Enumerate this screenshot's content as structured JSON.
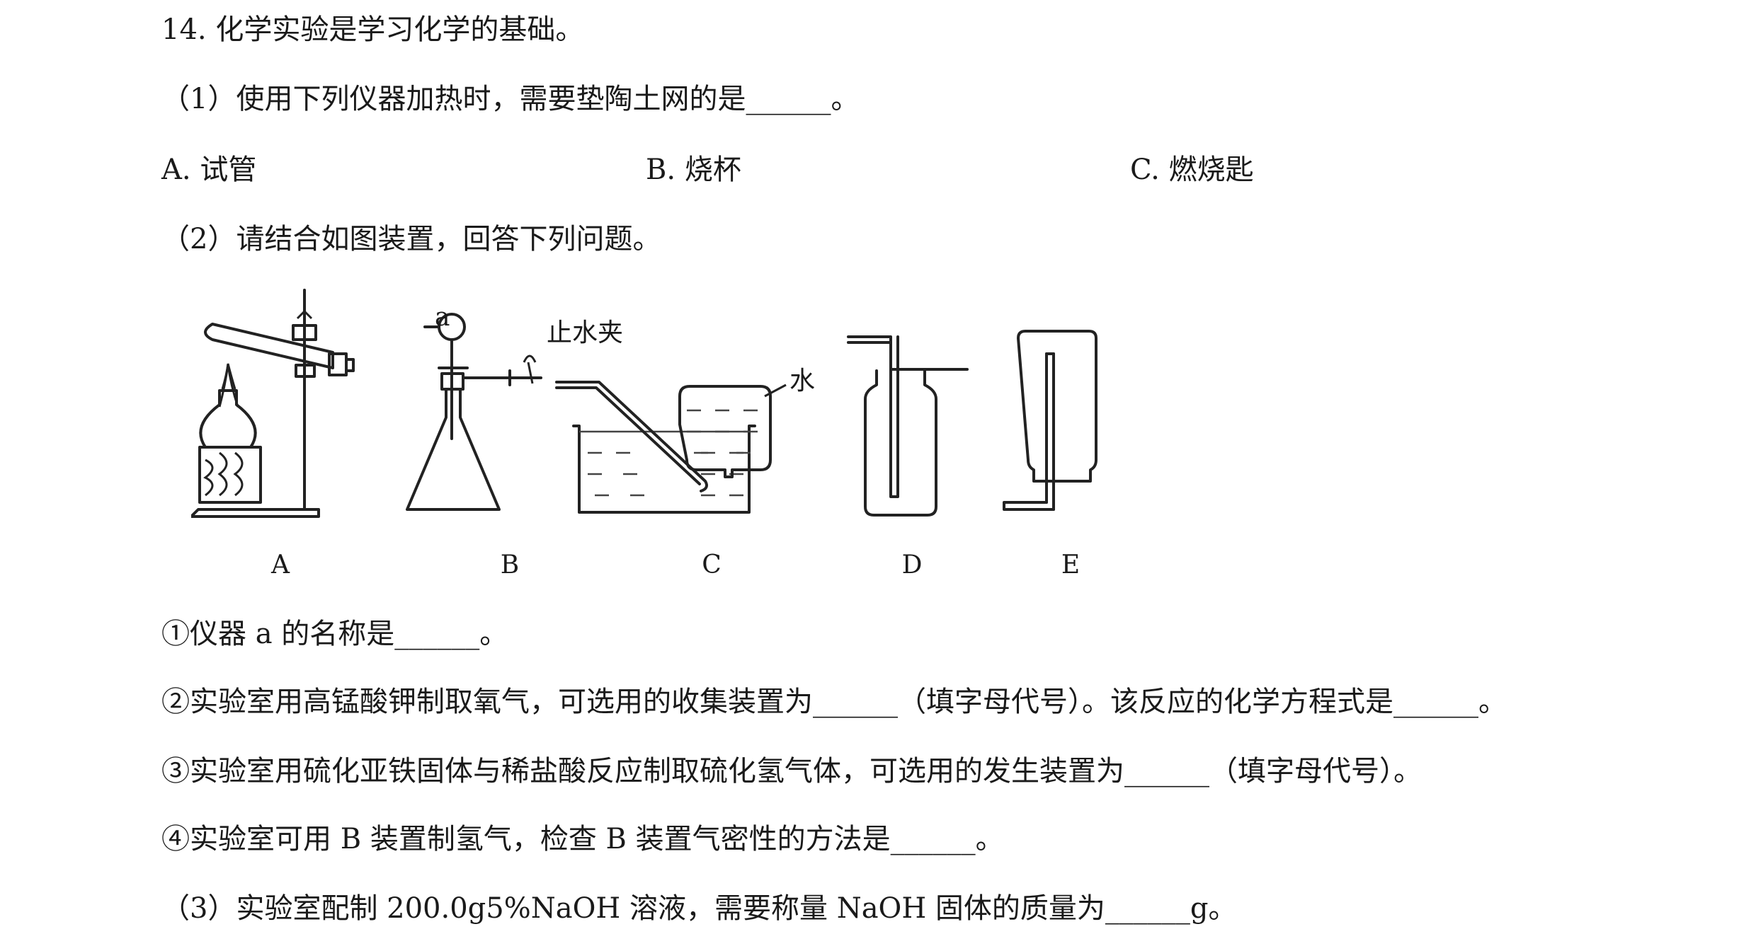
{
  "question": {
    "title": "14. 化学实验是学习化学的基础。",
    "part1": {
      "prompt": "（1）使用下列仪器加热时，需要垫陶土网的是______。",
      "options": [
        "A. 试管",
        "B. 烧杯",
        "C. 燃烧匙"
      ]
    },
    "part2": {
      "prompt": "（2）请结合如图装置，回答下列问题。",
      "figure": {
        "labels": [
          "A",
          "B",
          "C",
          "D",
          "E"
        ],
        "annotation_a": "a",
        "annotation_clamp": "止水夹",
        "annotation_water": "水"
      },
      "items": [
        "①仪器 a 的名称是______。",
        "②实验室用高锰酸钾制取氧气，可选用的收集装置为______（填字母代号）。该反应的化学方程式是______。",
        "③实验室用硫化亚铁固体与稀盐酸反应制取硫化氢气体，可选用的发生装置为______（填字母代号）。",
        "④实验室可用 B 装置制氢气，检查 B 装置气密性的方法是______。"
      ]
    },
    "part3": {
      "prompt": "（3）实验室配制 200.0g5%NaOH 溶液，需要称量 NaOH 固体的质量为______g。"
    }
  }
}
